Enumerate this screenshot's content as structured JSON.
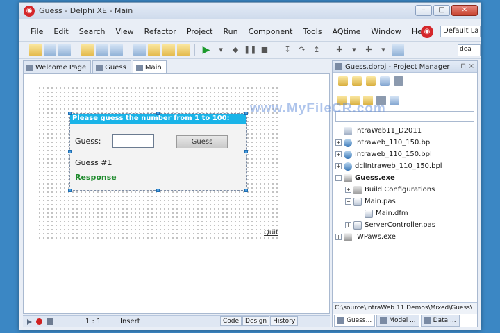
{
  "window": {
    "title": "Guess - Delphi XE - Main",
    "buttons": {
      "minimize": "–",
      "maximize": "□",
      "close": "✕"
    }
  },
  "menu": {
    "items": [
      "File",
      "Edit",
      "Search",
      "View",
      "Refactor",
      "Project",
      "Run",
      "Component",
      "Tools",
      "AQtime",
      "Window",
      "Help"
    ],
    "layout_combo": "Default La"
  },
  "toolbar": {
    "combo": "dea"
  },
  "tabs": [
    {
      "label": "Welcome Page"
    },
    {
      "label": "Guess"
    },
    {
      "label": "Main"
    }
  ],
  "form": {
    "header": "Please guess the number from 1 to 100:",
    "guess_label": "Guess:",
    "guess_value": "",
    "guess_button": "Guess",
    "count_label": "Guess #1",
    "response_label": "Response",
    "quit_link": "Quit"
  },
  "status": {
    "position": "1 : 1",
    "mode": "Insert",
    "tabs": [
      "Code",
      "Design",
      "History"
    ]
  },
  "project_manager": {
    "title": "Guess.dproj - Project Manager",
    "tree": [
      {
        "label": "IntraWeb11_D2011",
        "level": 0,
        "expander": "",
        "icon": "root",
        "bold": false
      },
      {
        "label": "Intraweb_110_150.bpl",
        "level": 0,
        "expander": "+",
        "icon": "pkg",
        "bold": false
      },
      {
        "label": "intraweb_110_150.bpl",
        "level": 0,
        "expander": "+",
        "icon": "pkg",
        "bold": false
      },
      {
        "label": "dclIntraweb_110_150.bpl",
        "level": 0,
        "expander": "+",
        "icon": "pkg",
        "bold": false
      },
      {
        "label": "Guess.exe",
        "level": 0,
        "expander": "−",
        "icon": "exe",
        "bold": true
      },
      {
        "label": "Build Configurations",
        "level": 1,
        "expander": "+",
        "icon": "cfg",
        "bold": false
      },
      {
        "label": "Main.pas",
        "level": 1,
        "expander": "−",
        "icon": "pas",
        "bold": false
      },
      {
        "label": "Main.dfm",
        "level": 2,
        "expander": "",
        "icon": "pas",
        "bold": false
      },
      {
        "label": "ServerController.pas",
        "level": 1,
        "expander": "+",
        "icon": "pas",
        "bold": false
      },
      {
        "label": "IWPaws.exe",
        "level": 0,
        "expander": "+",
        "icon": "exe",
        "bold": false
      }
    ],
    "path": "C:\\source\\IntraWeb 11 Demos\\Mixed\\Guess\\",
    "bottom_tabs": [
      "Guess...",
      "Model ...",
      "Data ..."
    ]
  },
  "watermark": "www.MyFileCR.com"
}
